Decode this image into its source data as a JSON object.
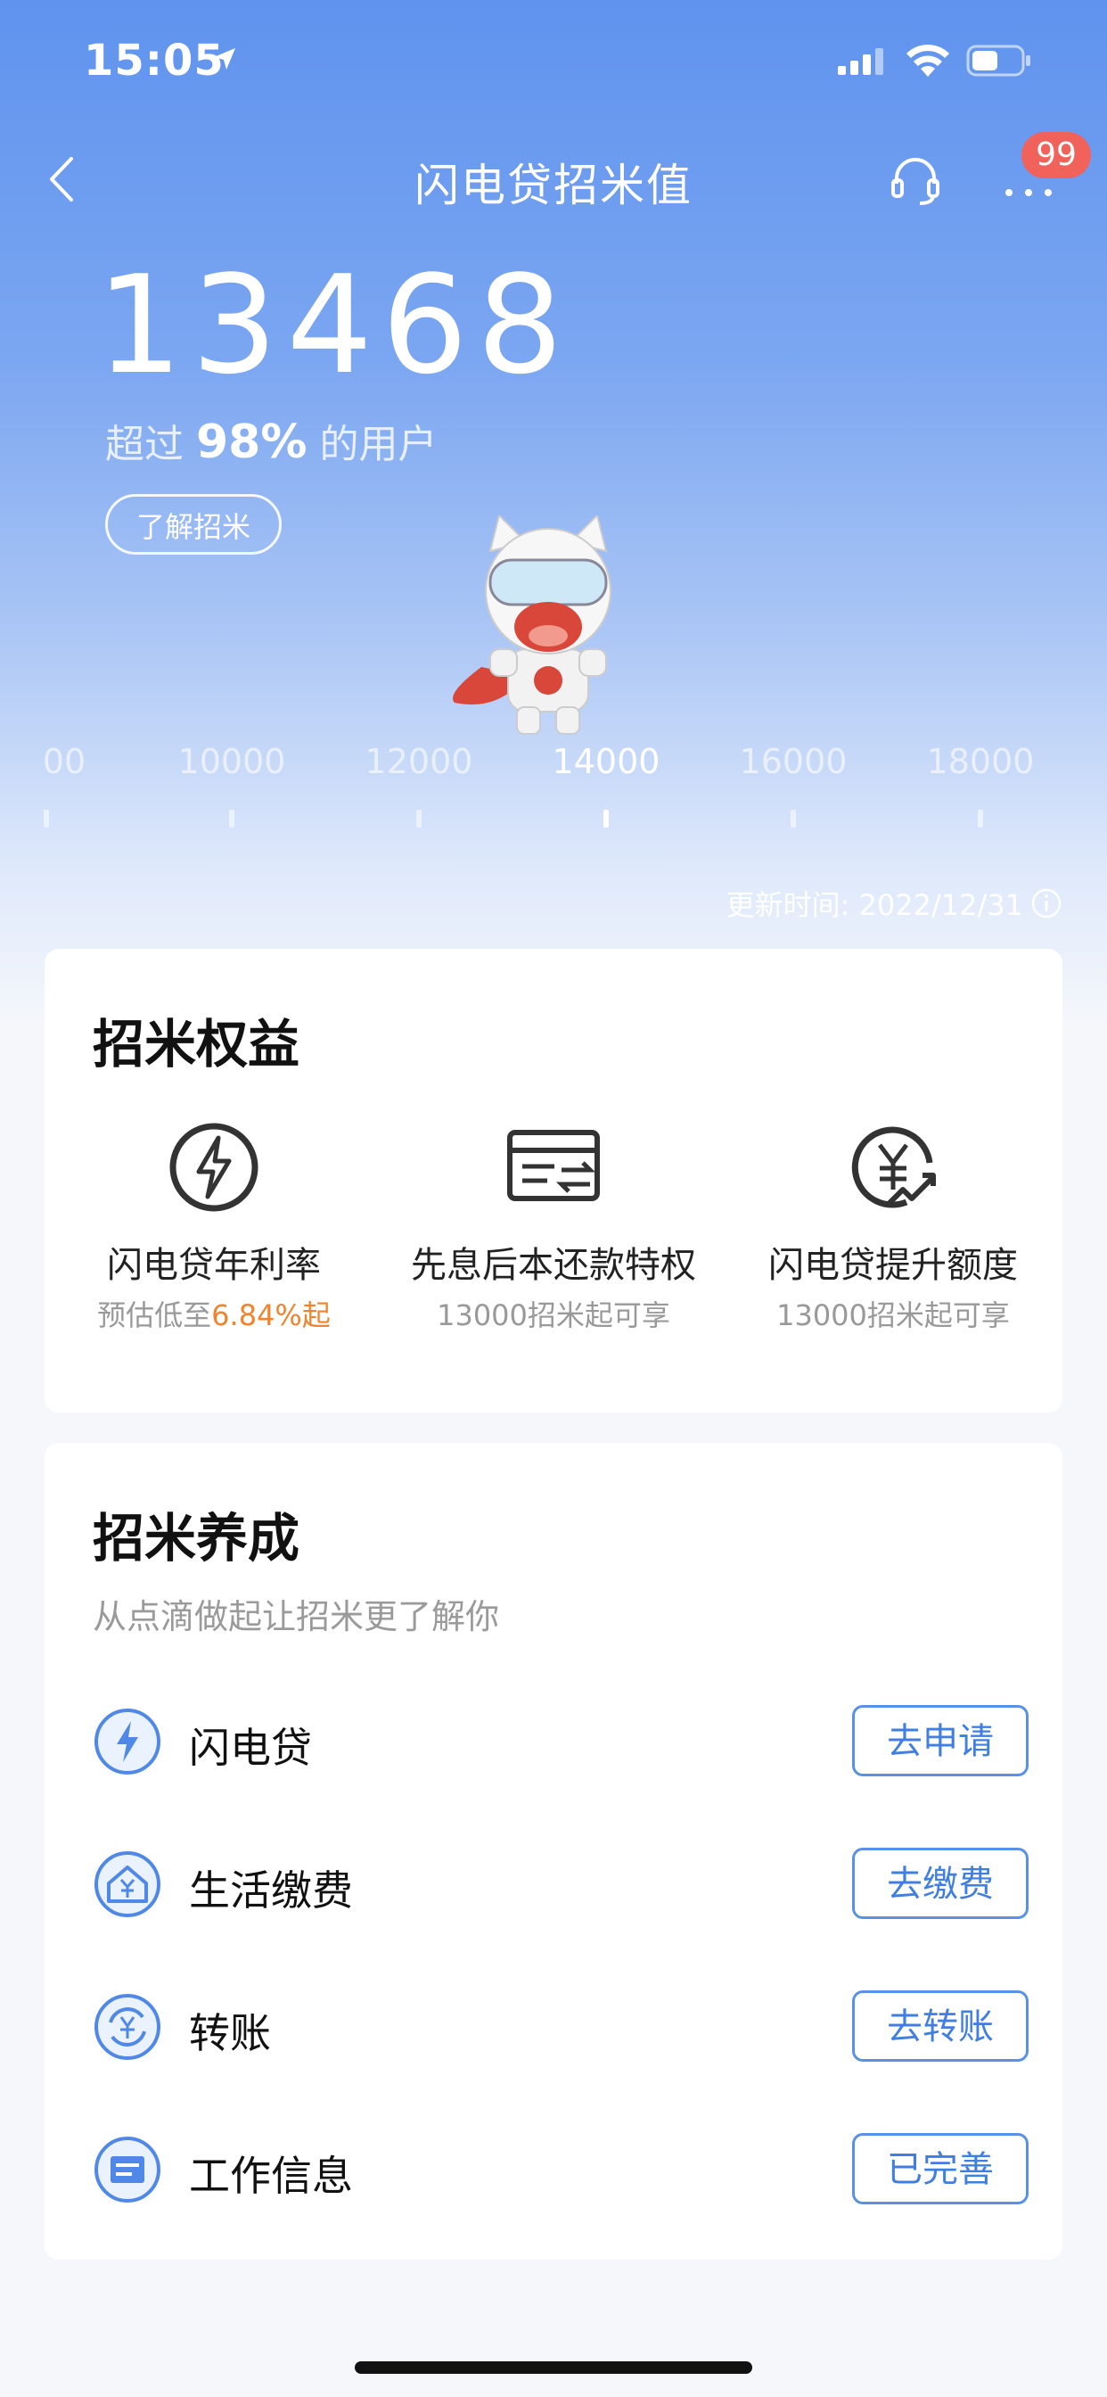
{
  "status_bar": {
    "time": "15:05"
  },
  "nav": {
    "title": "闪电贷招米值",
    "badge_count": "99"
  },
  "score": {
    "value": "13468",
    "beat_prefix": "超过",
    "beat_percent": "98%",
    "beat_suffix": "的用户",
    "learn_button": "了解招米"
  },
  "ruler": {
    "ticks": [
      {
        "label": "00",
        "active": false
      },
      {
        "label": "10000",
        "active": false
      },
      {
        "label": "12000",
        "active": false
      },
      {
        "label": "14000",
        "active": true
      },
      {
        "label": "16000",
        "active": false
      },
      {
        "label": "18000",
        "active": false
      }
    ]
  },
  "update_time": "更新时间: 2022/12/31",
  "benefits": {
    "title": "招米权益",
    "items": [
      {
        "icon": "lightning-icon",
        "name": "闪电贷年利率",
        "desc_prefix": "预估低至",
        "desc_highlight": "6.84%起",
        "desc_suffix": ""
      },
      {
        "icon": "card-transfer-icon",
        "name": "先息后本还款特权",
        "desc_prefix": "13000招米起可享",
        "desc_highlight": "",
        "desc_suffix": ""
      },
      {
        "icon": "yen-up-icon",
        "name": "闪电贷提升额度",
        "desc_prefix": "13000招米起可享",
        "desc_highlight": "",
        "desc_suffix": ""
      }
    ]
  },
  "cultivate": {
    "title": "招米养成",
    "subtitle": "从点滴做起让招米更了解你",
    "rows": [
      {
        "icon": "lightning-circle-icon",
        "label": "闪电贷",
        "button": "去申请"
      },
      {
        "icon": "house-yen-icon",
        "label": "生活缴费",
        "button": "去缴费"
      },
      {
        "icon": "yen-cycle-icon",
        "label": "转账",
        "button": "去转账"
      },
      {
        "icon": "id-card-icon",
        "label": "工作信息",
        "button": "已完善"
      }
    ]
  },
  "colors": {
    "accent": "#3f7fe4",
    "highlight": "#f0842e",
    "badge": "#f1625a"
  }
}
